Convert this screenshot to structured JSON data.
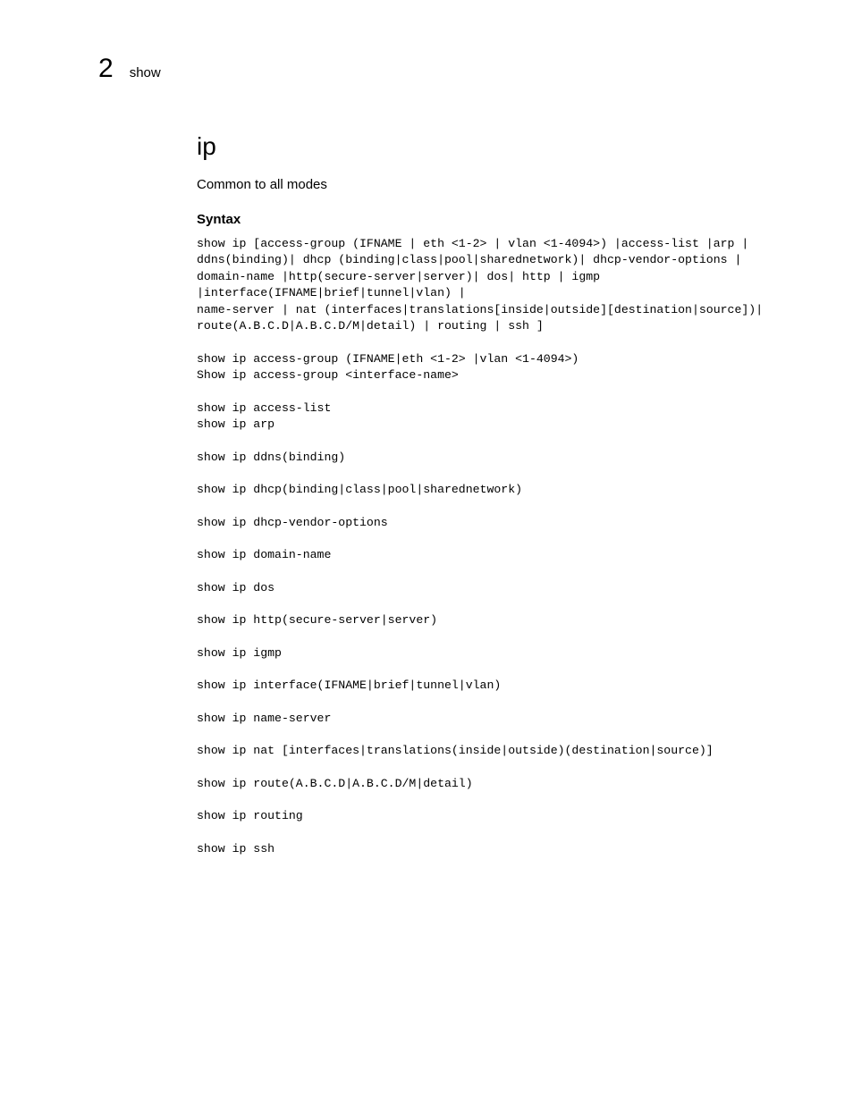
{
  "header": {
    "number": "2",
    "word": "show"
  },
  "title": "ip",
  "subtitle": "Common to all modes",
  "syntax_heading": "Syntax",
  "code_blocks": [
    "show ip [access-group (IFNAME | eth <1-2> | vlan <1-4094>) |access-list |arp |\nddns(binding)| dhcp (binding|class|pool|sharednetwork)| dhcp-vendor-options |\ndomain-name |http(secure-server|server)| dos| http | igmp\n|interface(IFNAME|brief|tunnel|vlan) |\nname-server | nat (interfaces|translations[inside|outside][destination|source])|\nroute(A.B.C.D|A.B.C.D/M|detail) | routing | ssh ]",
    "show ip access-group (IFNAME|eth <1-2> |vlan <1-4094>)\nShow ip access-group <interface-name>",
    "show ip access-list\nshow ip arp",
    "show ip ddns(binding)",
    "show ip dhcp(binding|class|pool|sharednetwork)",
    "show ip dhcp-vendor-options",
    "show ip domain-name",
    "show ip dos",
    "show ip http(secure-server|server)",
    "show ip igmp",
    "show ip interface(IFNAME|brief|tunnel|vlan)",
    "show ip name-server",
    "show ip nat [interfaces|translations(inside|outside)(destination|source)]",
    "show ip route(A.B.C.D|A.B.C.D/M|detail)",
    "show ip routing",
    "show ip ssh"
  ]
}
